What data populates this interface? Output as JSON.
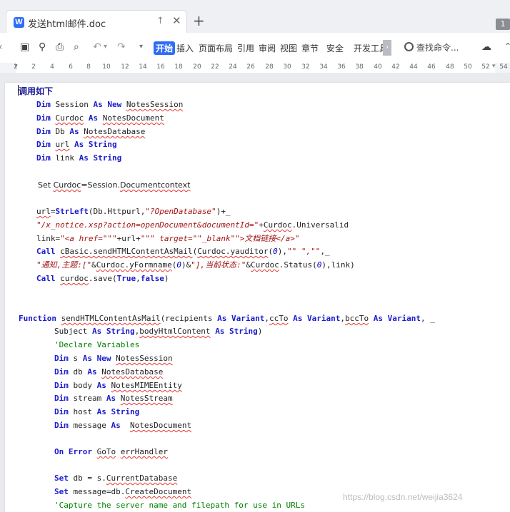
{
  "tab": {
    "icon_letter": "W",
    "title": "发送html邮件.doc"
  },
  "window": {
    "badge": "1"
  },
  "ribbon": {
    "menus": [
      "开始",
      "插入",
      "页面布局",
      "引用",
      "审阅",
      "视图",
      "章节",
      "安全",
      "开发工具"
    ],
    "search_label": "查找命令..."
  },
  "ruler": {
    "ticks": [
      "2",
      "2",
      "4",
      "6",
      "8",
      "10",
      "12",
      "14",
      "16",
      "18",
      "20",
      "22",
      "24",
      "26",
      "28",
      "30",
      "32",
      "34",
      "36",
      "38",
      "40",
      "42",
      "44",
      "46",
      "48",
      "50",
      "52",
      "54"
    ]
  },
  "document": {
    "heading": "调用如下",
    "lines": [
      {
        "segs": [
          [
            "k",
            "Dim "
          ],
          [
            "",
            "Session "
          ],
          [
            "k",
            "As New "
          ],
          [
            "u",
            "NotesSession"
          ]
        ]
      },
      {
        "segs": [
          [
            "k",
            "Dim "
          ],
          [
            "u",
            "Curdoc"
          ],
          [
            "",
            " "
          ],
          [
            "k",
            "As "
          ],
          [
            "u",
            "NotesDocument"
          ]
        ]
      },
      {
        "segs": [
          [
            "k",
            "Dim "
          ],
          [
            "",
            "Db "
          ],
          [
            "k",
            "As "
          ],
          [
            "u",
            "NotesDatabase"
          ]
        ]
      },
      {
        "segs": [
          [
            "k",
            "Dim "
          ],
          [
            "u",
            "url"
          ],
          [
            "",
            " "
          ],
          [
            "k",
            "As String"
          ]
        ]
      },
      {
        "segs": [
          [
            "k",
            "Dim "
          ],
          [
            "",
            "link "
          ],
          [
            "k",
            "As String"
          ]
        ]
      },
      {
        "segs": []
      },
      {
        "prop": true,
        "segs": [
          [
            "",
            "Set "
          ],
          [
            "u",
            "Curdoc"
          ],
          [
            "",
            "=Session."
          ],
          [
            "u",
            "Documentcontext"
          ]
        ]
      },
      {
        "segs": []
      },
      {
        "segs": [
          [
            "u",
            "url"
          ],
          [
            "",
            "="
          ],
          [
            "k",
            "StrLeft"
          ],
          [
            "",
            "(Db.Httpurl,"
          ],
          [
            "str",
            "\"?OpenDatabase\""
          ],
          [
            "",
            ")+_"
          ]
        ]
      },
      {
        "segs": [
          [
            "str",
            "\"/x_notice.xsp?action=openDocument&documentId=\""
          ],
          [
            "",
            "+"
          ],
          [
            "u",
            "Curdoc"
          ],
          [
            "",
            ".Universalid"
          ]
        ]
      },
      {
        "segs": [
          [
            "",
            "link="
          ],
          [
            "str",
            "\"<a href=\"\"\""
          ],
          [
            "",
            "+url+"
          ],
          [
            "str",
            "\"\"\" target=\"\"_blank\"\">文档链接</a>\""
          ]
        ]
      },
      {
        "segs": [
          [
            "k",
            "Call "
          ],
          [
            "u",
            "cBasic.sendHTMLContentAsMail"
          ],
          [
            "",
            "("
          ],
          [
            "u",
            "Curdoc.yauditor"
          ],
          [
            "",
            "("
          ],
          [
            "num",
            "0"
          ],
          [
            "",
            "),"
          ],
          [
            "str",
            "\"\" \",\"\""
          ],
          [
            "",
            ",_"
          ]
        ]
      },
      {
        "segs": [
          [
            "str",
            "\"通知,主题:[\""
          ],
          [
            "",
            "&"
          ],
          [
            "u",
            "Curdoc.yFormname"
          ],
          [
            "",
            "("
          ],
          [
            "num",
            "0"
          ],
          [
            "",
            ")&"
          ],
          [
            "str",
            "\"],当前状态:\""
          ],
          [
            "",
            "&"
          ],
          [
            "u",
            "Curdoc"
          ],
          [
            "",
            ".Status("
          ],
          [
            "num",
            "0"
          ],
          [
            "",
            "),link)"
          ]
        ]
      },
      {
        "segs": [
          [
            "k",
            "Call "
          ],
          [
            "u",
            "curdoc"
          ],
          [
            "",
            ".save("
          ],
          [
            "k",
            "True"
          ],
          [
            "",
            ","
          ],
          [
            "k",
            "false"
          ],
          [
            "",
            ")"
          ]
        ]
      },
      {
        "segs": []
      },
      {
        "segs": []
      },
      {
        "segs": []
      },
      {
        "segs": [
          [
            "k",
            "Function "
          ],
          [
            "u",
            "sendHTMLContentAsMail"
          ],
          [
            "",
            "(recipients "
          ],
          [
            "k",
            "As Variant"
          ],
          [
            "",
            ","
          ],
          [
            "u",
            "ccTo"
          ],
          [
            "",
            " "
          ],
          [
            "k",
            "As Variant"
          ],
          [
            "",
            ","
          ],
          [
            "u",
            "bccTo"
          ],
          [
            "",
            " "
          ],
          [
            "k",
            "As Variant"
          ],
          [
            "",
            ", _"
          ]
        ]
      },
      {
        "segs": [
          [
            "",
            "Subject "
          ],
          [
            "k",
            "As String"
          ],
          [
            "",
            ","
          ],
          [
            "u",
            "bodyHtmlContent"
          ],
          [
            "",
            " "
          ],
          [
            "k",
            "As String"
          ],
          [
            "",
            ")"
          ]
        ]
      },
      {
        "segs": [
          [
            "cm",
            "'Declare Variables"
          ]
        ]
      },
      {
        "segs": [
          [
            "k",
            "Dim "
          ],
          [
            "",
            "s "
          ],
          [
            "k",
            "As New "
          ],
          [
            "u",
            "NotesSession"
          ]
        ]
      },
      {
        "segs": [
          [
            "k",
            "Dim "
          ],
          [
            "",
            "db "
          ],
          [
            "k",
            "As "
          ],
          [
            "u",
            "NotesDatabase"
          ]
        ]
      },
      {
        "segs": [
          [
            "k",
            "Dim "
          ],
          [
            "",
            "body "
          ],
          [
            "k",
            "As "
          ],
          [
            "u",
            "NotesMIMEEntity"
          ]
        ]
      },
      {
        "segs": [
          [
            "k",
            "Dim "
          ],
          [
            "",
            "stream "
          ],
          [
            "k",
            "As "
          ],
          [
            "u",
            "NotesStream"
          ]
        ]
      },
      {
        "segs": [
          [
            "k",
            "Dim "
          ],
          [
            "",
            "host "
          ],
          [
            "k",
            "As String"
          ]
        ]
      },
      {
        "segs": [
          [
            "k",
            "Dim "
          ],
          [
            "",
            "message "
          ],
          [
            "k",
            "As  "
          ],
          [
            "u",
            "NotesDocument"
          ]
        ]
      },
      {
        "segs": []
      },
      {
        "segs": [
          [
            "k",
            "On Error "
          ],
          [
            "u",
            "GoTo"
          ],
          [
            "",
            " "
          ],
          [
            "u",
            "errHandler"
          ]
        ]
      },
      {
        "segs": []
      },
      {
        "segs": [
          [
            "k",
            "Set "
          ],
          [
            "",
            "db = s."
          ],
          [
            "u",
            "CurrentDatabase"
          ]
        ]
      },
      {
        "segs": [
          [
            "k",
            "Set "
          ],
          [
            "",
            "message=db."
          ],
          [
            "u",
            "CreateDocument"
          ]
        ]
      },
      {
        "segs": [
          [
            "cm",
            "'Capture the server name and filepath for use in URLs"
          ]
        ]
      }
    ]
  },
  "watermark": "https://blog.csdn.net/weijia3624"
}
